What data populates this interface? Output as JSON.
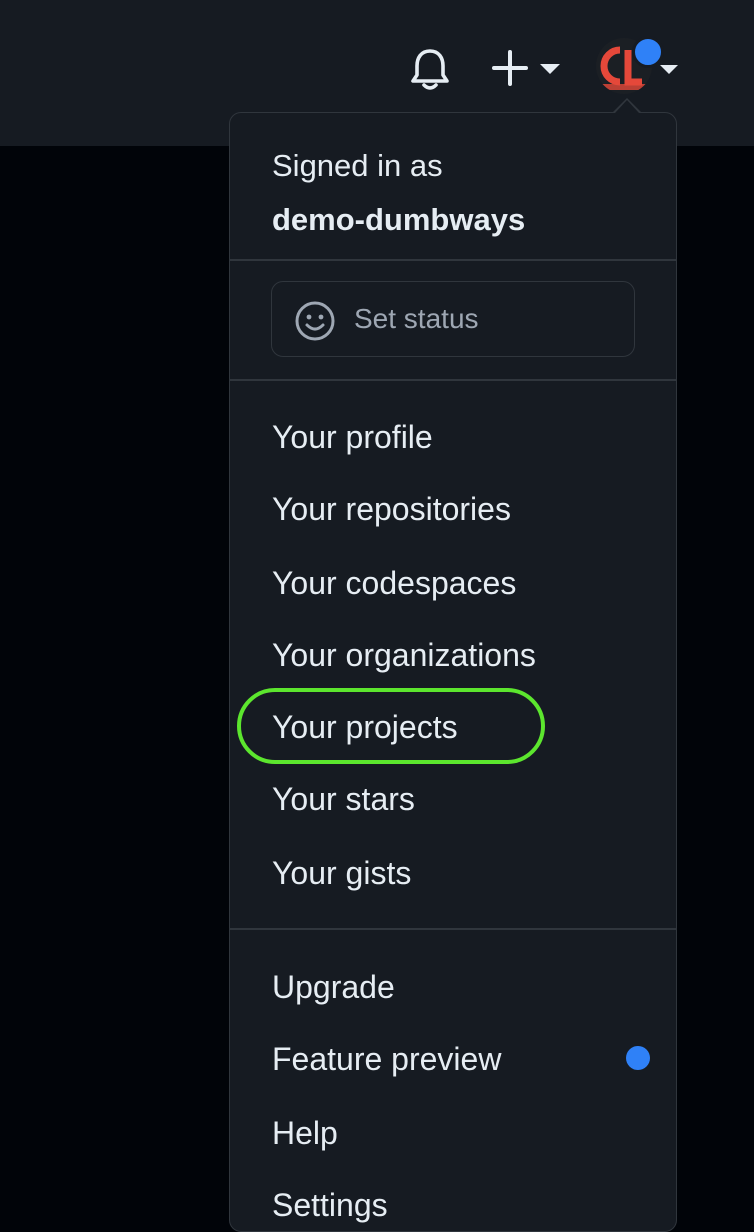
{
  "header": {
    "bell_icon": "bell-icon",
    "create_icon": "plus-icon",
    "avatar_icon": "avatar-icon",
    "notification_color": "#2f81f7"
  },
  "menu": {
    "signed_in_label": "Signed in as",
    "username": "demo-dumbways",
    "set_status": {
      "icon": "smiley-icon",
      "label": "Set status"
    },
    "items": [
      {
        "label": "Your profile"
      },
      {
        "label": "Your repositories"
      },
      {
        "label": "Your codespaces"
      },
      {
        "label": "Your organizations"
      },
      {
        "label": "Your projects",
        "highlighted": true
      },
      {
        "label": "Your stars"
      },
      {
        "label": "Your gists"
      }
    ],
    "secondary_items": [
      {
        "label": "Upgrade"
      },
      {
        "label": "Feature preview",
        "badge_color": "#2f81f7"
      },
      {
        "label": "Help"
      },
      {
        "label": "Settings"
      }
    ]
  },
  "highlight_color": "#5ce62e"
}
